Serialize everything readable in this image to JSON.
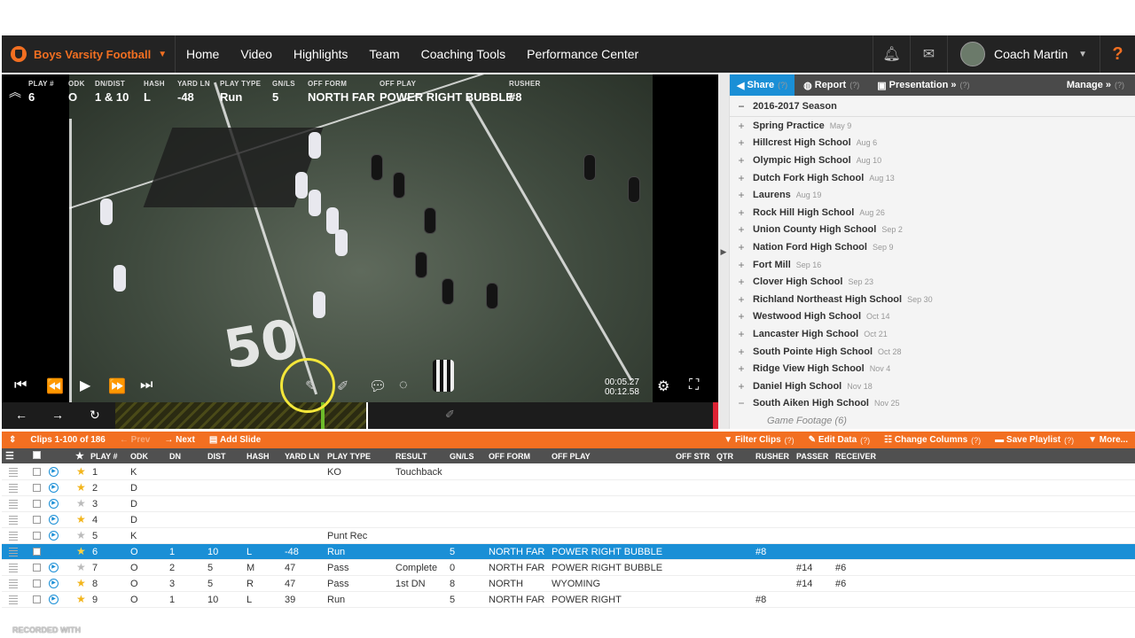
{
  "topnav": {
    "team": "Boys Varsity Football",
    "items": [
      "Home",
      "Video",
      "Highlights",
      "Team",
      "Coaching Tools",
      "Performance Center"
    ],
    "user": "Coach Martin",
    "help": "?"
  },
  "overlay": {
    "fields": [
      {
        "label": "PLAY #",
        "value": "6"
      },
      {
        "label": "ODK",
        "value": "O"
      },
      {
        "label": "DN/DIST",
        "value": "1 & 10"
      },
      {
        "label": "HASH",
        "value": "L"
      },
      {
        "label": "YARD LN",
        "value": "-48"
      },
      {
        "label": "PLAY TYPE",
        "value": "Run"
      },
      {
        "label": "GN/LS",
        "value": "5"
      },
      {
        "label": "OFF FORM",
        "value": "NORTH FAR"
      },
      {
        "label": "OFF PLAY",
        "value": "POWER RIGHT BUBBLE"
      },
      {
        "label": "RUSHER",
        "value": "#8"
      }
    ],
    "field_numeral": "50",
    "time_current": "00:05.27",
    "time_total": "00:12.58"
  },
  "panel": {
    "share": "Share",
    "report": "Report",
    "presentation": "Presentation »",
    "manage": "Manage »",
    "q": "(?)",
    "season": "2016-2017 Season",
    "games": [
      {
        "name": "Spring Practice",
        "date": "May 9"
      },
      {
        "name": "Hillcrest High School",
        "date": "Aug 6"
      },
      {
        "name": "Olympic High School",
        "date": "Aug 10"
      },
      {
        "name": "Dutch Fork High School",
        "date": "Aug 13"
      },
      {
        "name": "Laurens",
        "date": "Aug 19"
      },
      {
        "name": "Rock Hill High School",
        "date": "Aug 26"
      },
      {
        "name": "Union County High School",
        "date": "Sep 2"
      },
      {
        "name": "Nation Ford High School",
        "date": "Sep 9"
      },
      {
        "name": "Fort Mill",
        "date": "Sep 16"
      },
      {
        "name": "Clover High School",
        "date": "Sep 23"
      },
      {
        "name": "Richland Northeast High School",
        "date": "Sep 30"
      },
      {
        "name": "Westwood High School",
        "date": "Oct 14"
      },
      {
        "name": "Lancaster High School",
        "date": "Oct 21"
      },
      {
        "name": "South Pointe High School",
        "date": "Oct 28"
      },
      {
        "name": "Ridge View High School",
        "date": "Nov 4"
      },
      {
        "name": "Daniel High School",
        "date": "Nov 18"
      },
      {
        "name": "South Aiken High School",
        "date": "Nov 25"
      }
    ],
    "sub_item": "Game Footage (6)"
  },
  "clipbar": {
    "clips": "Clips 1-100 of 186",
    "prev": "Prev",
    "next": "Next",
    "add_slide": "Add Slide",
    "filter": "Filter Clips",
    "edit": "Edit Data",
    "columns": "Change Columns",
    "save": "Save Playlist",
    "more": "More...",
    "q": "(?)"
  },
  "columns": [
    "PLAY #",
    "ODK",
    "DN",
    "DIST",
    "HASH",
    "YARD LN",
    "PLAY TYPE",
    "RESULT",
    "GN/LS",
    "OFF FORM",
    "OFF PLAY",
    "OFF STR",
    "QTR",
    "RUSHER",
    "PASSER",
    "RECEIVER"
  ],
  "rows": [
    {
      "play": "1",
      "odk": "K",
      "dn": "",
      "dist": "",
      "hash": "",
      "yard": "",
      "type": "KO",
      "result": "Touchback",
      "gnls": "",
      "form": "",
      "offplay": "",
      "str": "",
      "qtr": "",
      "rusher": "",
      "passer": "",
      "receiver": "",
      "star": true
    },
    {
      "play": "2",
      "odk": "D",
      "dn": "",
      "dist": "",
      "hash": "",
      "yard": "",
      "type": "",
      "result": "",
      "gnls": "",
      "form": "",
      "offplay": "",
      "str": "",
      "qtr": "",
      "rusher": "",
      "passer": "",
      "receiver": "",
      "star": true
    },
    {
      "play": "3",
      "odk": "D",
      "dn": "",
      "dist": "",
      "hash": "",
      "yard": "",
      "type": "",
      "result": "",
      "gnls": "",
      "form": "",
      "offplay": "",
      "str": "",
      "qtr": "",
      "rusher": "",
      "passer": "",
      "receiver": "",
      "star": false
    },
    {
      "play": "4",
      "odk": "D",
      "dn": "",
      "dist": "",
      "hash": "",
      "yard": "",
      "type": "",
      "result": "",
      "gnls": "",
      "form": "",
      "offplay": "",
      "str": "",
      "qtr": "",
      "rusher": "",
      "passer": "",
      "receiver": "",
      "star": true
    },
    {
      "play": "5",
      "odk": "K",
      "dn": "",
      "dist": "",
      "hash": "",
      "yard": "",
      "type": "Punt Rec",
      "result": "",
      "gnls": "",
      "form": "",
      "offplay": "",
      "str": "",
      "qtr": "",
      "rusher": "",
      "passer": "",
      "receiver": "",
      "star": false
    },
    {
      "play": "6",
      "odk": "O",
      "dn": "1",
      "dist": "10",
      "hash": "L",
      "yard": "-48",
      "type": "Run",
      "result": "",
      "gnls": "5",
      "form": "NORTH FAR",
      "offplay": "POWER RIGHT BUBBLE",
      "str": "",
      "qtr": "",
      "rusher": "#8",
      "passer": "",
      "receiver": "",
      "star": true,
      "selected": true
    },
    {
      "play": "7",
      "odk": "O",
      "dn": "2",
      "dist": "5",
      "hash": "M",
      "yard": "47",
      "type": "Pass",
      "result": "Complete",
      "gnls": "0",
      "form": "NORTH FAR",
      "offplay": "POWER RIGHT BUBBLE",
      "str": "",
      "qtr": "",
      "rusher": "",
      "passer": "#14",
      "receiver": "#6",
      "star": false
    },
    {
      "play": "8",
      "odk": "O",
      "dn": "3",
      "dist": "5",
      "hash": "R",
      "yard": "47",
      "type": "Pass",
      "result": "1st DN",
      "gnls": "8",
      "form": "NORTH",
      "offplay": "WYOMING",
      "str": "",
      "qtr": "",
      "rusher": "",
      "passer": "#14",
      "receiver": "#6",
      "star": true
    },
    {
      "play": "9",
      "odk": "O",
      "dn": "1",
      "dist": "10",
      "hash": "L",
      "yard": "39",
      "type": "Run",
      "result": "",
      "gnls": "5",
      "form": "NORTH FAR",
      "offplay": "POWER RIGHT",
      "str": "",
      "qtr": "",
      "rusher": "#8",
      "passer": "",
      "receiver": "",
      "star": true
    }
  ],
  "watermark": "RECORDED WITH"
}
